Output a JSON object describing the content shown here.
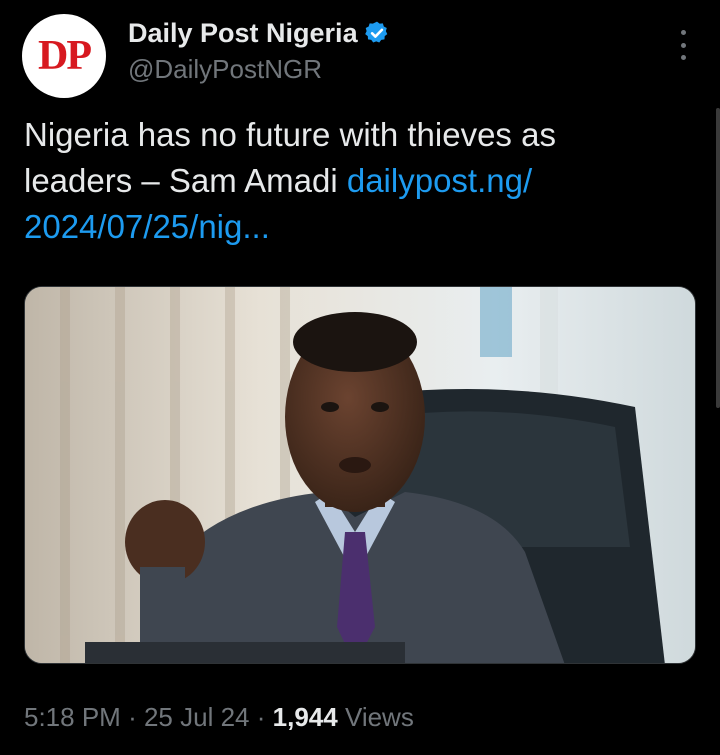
{
  "author": {
    "display_name": "Daily Post Nigeria",
    "handle": "@DailyPostNGR",
    "avatar_text": "DP",
    "verified": true
  },
  "tweet": {
    "text": "Nigeria has no future with thieves as leaders – Sam Amadi ",
    "link_text": "dailypost.ng/ 2024/07/25/nig..."
  },
  "meta": {
    "time": "5:18 PM",
    "separator": "·",
    "date": "25 Jul 24",
    "views_count": "1,944",
    "views_label": "Views"
  },
  "colors": {
    "background": "#000000",
    "text": "#e7e9ea",
    "secondary": "#71767b",
    "link": "#1d9bf0",
    "brand_red": "#d71920"
  },
  "icons": {
    "verified": "verified-badge-icon",
    "more": "more-options-icon"
  }
}
